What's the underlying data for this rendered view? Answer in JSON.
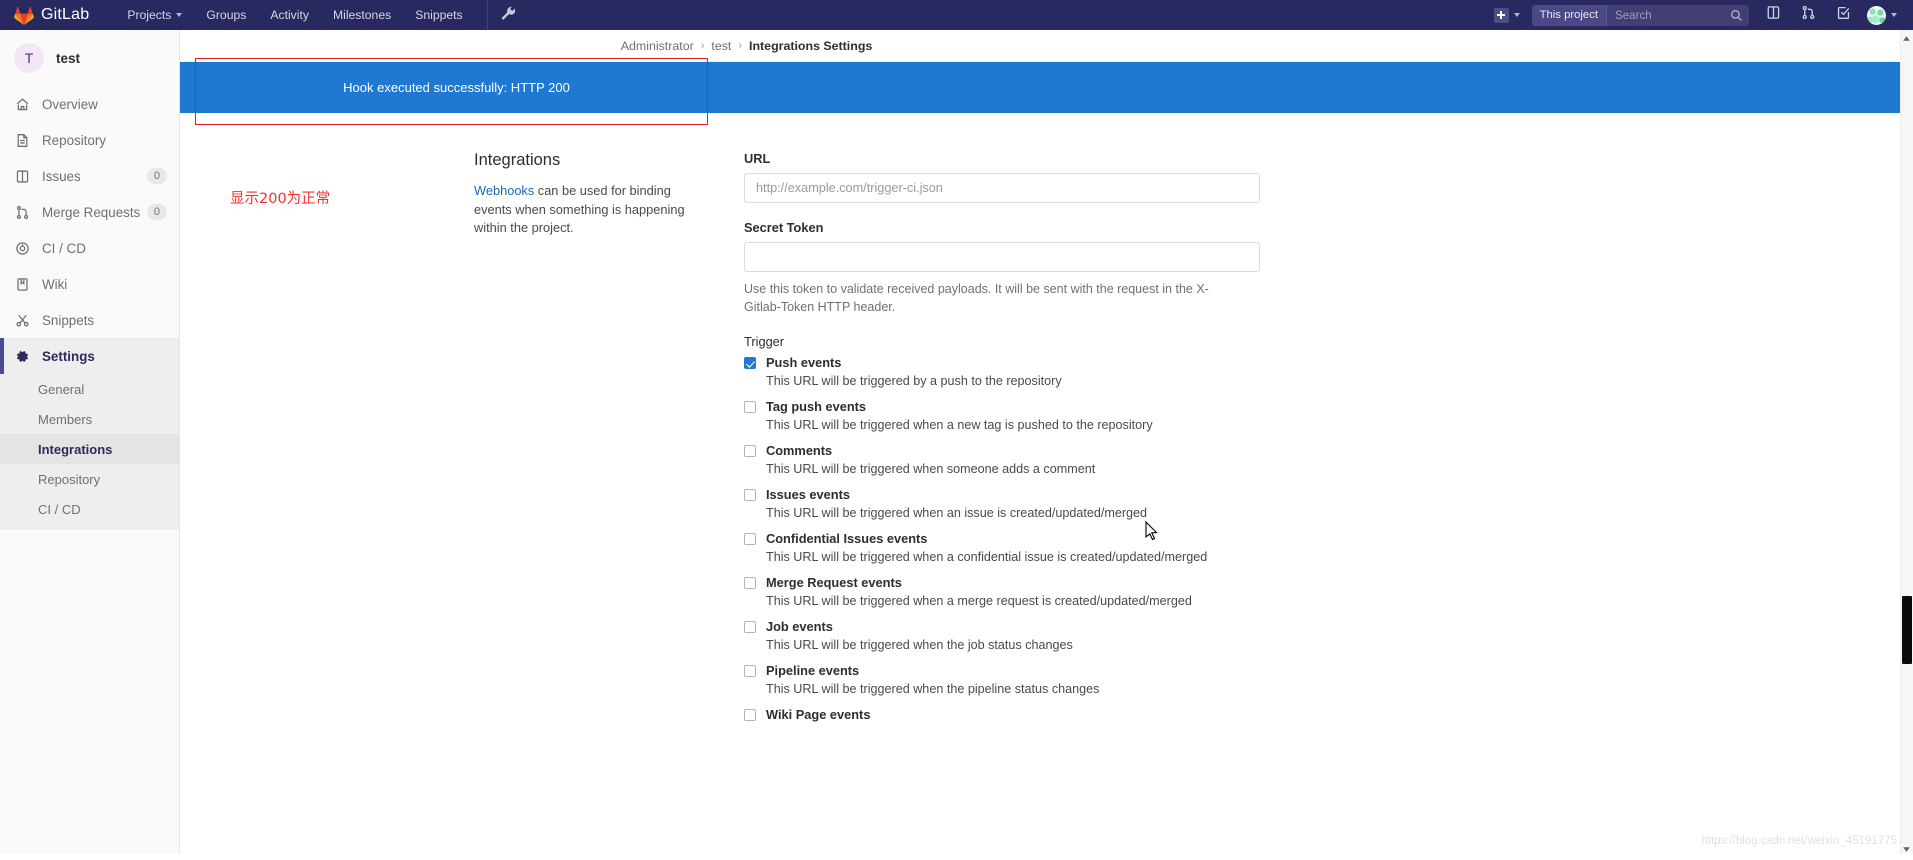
{
  "navbar": {
    "brand": "GitLab",
    "logo_icon": "gitlab-fox-icon",
    "links": [
      {
        "label": "Projects",
        "has_caret": true
      },
      {
        "label": "Groups",
        "has_caret": false
      },
      {
        "label": "Activity",
        "has_caret": false
      },
      {
        "label": "Milestones",
        "has_caret": false
      },
      {
        "label": "Snippets",
        "has_caret": false
      }
    ],
    "admin_icon": "wrench-icon",
    "new_icon": "plus-square-icon",
    "search": {
      "scope_label": "This project",
      "placeholder": "Search",
      "value": "",
      "icon": "search-icon"
    },
    "right_icons": [
      {
        "name": "issues-icon"
      },
      {
        "name": "merge-requests-icon"
      },
      {
        "name": "todos-icon"
      }
    ],
    "avatar": {
      "name": "user-avatar",
      "has_caret": true
    }
  },
  "sidebar": {
    "project": {
      "initial": "T",
      "name": "test"
    },
    "items": [
      {
        "label": "Overview",
        "icon": "home-icon",
        "count": null,
        "active": false
      },
      {
        "label": "Repository",
        "icon": "document-icon",
        "count": null,
        "active": false
      },
      {
        "label": "Issues",
        "icon": "issues-icon",
        "count": "0",
        "active": false
      },
      {
        "label": "Merge Requests",
        "icon": "merge-requests-icon",
        "count": "0",
        "active": false
      },
      {
        "label": "CI / CD",
        "icon": "rocket-icon",
        "count": null,
        "active": false
      },
      {
        "label": "Wiki",
        "icon": "book-icon",
        "count": null,
        "active": false
      },
      {
        "label": "Snippets",
        "icon": "scissors-icon",
        "count": null,
        "active": false
      },
      {
        "label": "Settings",
        "icon": "gear-icon",
        "count": null,
        "active": true
      }
    ],
    "subitems": [
      {
        "label": "General",
        "active": false
      },
      {
        "label": "Members",
        "active": false
      },
      {
        "label": "Integrations",
        "active": true
      },
      {
        "label": "Repository",
        "active": false
      },
      {
        "label": "CI / CD",
        "active": false
      }
    ]
  },
  "breadcrumb": {
    "items": [
      "Administrator",
      "test"
    ],
    "current": "Integrations Settings",
    "separator": "›"
  },
  "alert": {
    "message": "Hook executed successfully: HTTP 200",
    "color": "#1f78d1"
  },
  "annotation": {
    "text": "显示200为正常",
    "color": "#ff2d2d",
    "box_color": "#e02020"
  },
  "integrations": {
    "title": "Integrations",
    "desc_link": "Webhooks",
    "desc_rest": " can be used for binding events when something is happening within the project."
  },
  "form": {
    "url_label": "URL",
    "url_placeholder": "http://example.com/trigger-ci.json",
    "url_value": "",
    "token_label": "Secret Token",
    "token_value": "",
    "token_help": "Use this token to validate received payloads. It will be sent with the request in the X-Gitlab-Token HTTP header.",
    "trigger_label": "Trigger",
    "triggers": [
      {
        "label": "Push events",
        "desc": "This URL will be triggered by a push to the repository",
        "checked": true
      },
      {
        "label": "Tag push events",
        "desc": "This URL will be triggered when a new tag is pushed to the repository",
        "checked": false
      },
      {
        "label": "Comments",
        "desc": "This URL will be triggered when someone adds a comment",
        "checked": false
      },
      {
        "label": "Issues events",
        "desc": "This URL will be triggered when an issue is created/updated/merged",
        "checked": false
      },
      {
        "label": "Confidential Issues events",
        "desc": "This URL will be triggered when a confidential issue is created/updated/merged",
        "checked": false
      },
      {
        "label": "Merge Request events",
        "desc": "This URL will be triggered when a merge request is created/updated/merged",
        "checked": false
      },
      {
        "label": "Job events",
        "desc": "This URL will be triggered when the job status changes",
        "checked": false
      },
      {
        "label": "Pipeline events",
        "desc": "This URL will be triggered when the pipeline status changes",
        "checked": false
      },
      {
        "label": "Wiki Page events",
        "desc": "",
        "checked": false
      }
    ]
  },
  "watermark": {
    "text": "https://blog.csdn.net/weixin_45191775"
  }
}
